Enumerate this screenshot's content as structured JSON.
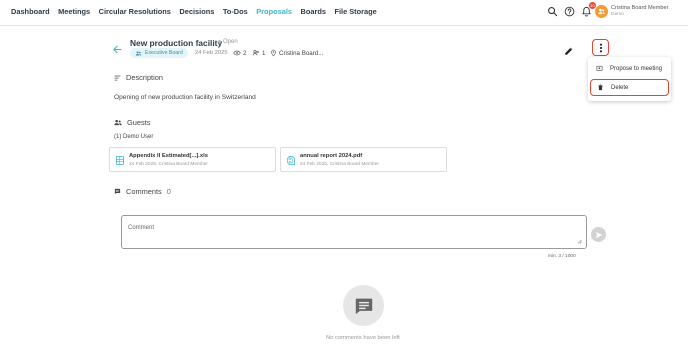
{
  "nav": {
    "items": [
      {
        "label": "Dashboard"
      },
      {
        "label": "Meetings"
      },
      {
        "label": "Circular Resolutions"
      },
      {
        "label": "Decisions"
      },
      {
        "label": "To-Dos"
      },
      {
        "label": "Proposals",
        "active": true
      },
      {
        "label": "Boards"
      },
      {
        "label": "File Storage"
      }
    ],
    "notification_count": "10",
    "user_name": "Cristina Board Member",
    "user_role": "Demo",
    "icons": [
      "search-icon",
      "help-icon",
      "bell-icon"
    ]
  },
  "proposal": {
    "title": "New production facility",
    "status": "Open",
    "board": "Executive Board",
    "date": "24 Feb 2025",
    "views": "2",
    "guests_count": "1",
    "owner": "Cristina Board..."
  },
  "menu": {
    "propose_label": "Propose to meeting",
    "delete_label": "Delete"
  },
  "description": {
    "heading": "Description",
    "text": "Opening of new production facility in Switzerland"
  },
  "guests": {
    "heading": "Guests",
    "list_text": "(1) Demo User"
  },
  "attachments": [
    {
      "name": "Appendix II Estimated[...].xls",
      "meta": "24 Feb 2025, Cristina Board Member",
      "icon": "spreadsheet-icon"
    },
    {
      "name": "annual report 2024.pdf",
      "meta": "24 Feb 2025, Cristina Board Member",
      "icon": "document-icon"
    }
  ],
  "comments": {
    "heading": "Comments",
    "count": "0",
    "placeholder": "Comment",
    "counter": "min. 3 / 1000",
    "empty_text": "No comments have been left"
  },
  "colors": {
    "accent": "#3fb4c9",
    "highlight": "#e0453a",
    "badge": "#e94b3c",
    "avatar": "#f29b38"
  }
}
